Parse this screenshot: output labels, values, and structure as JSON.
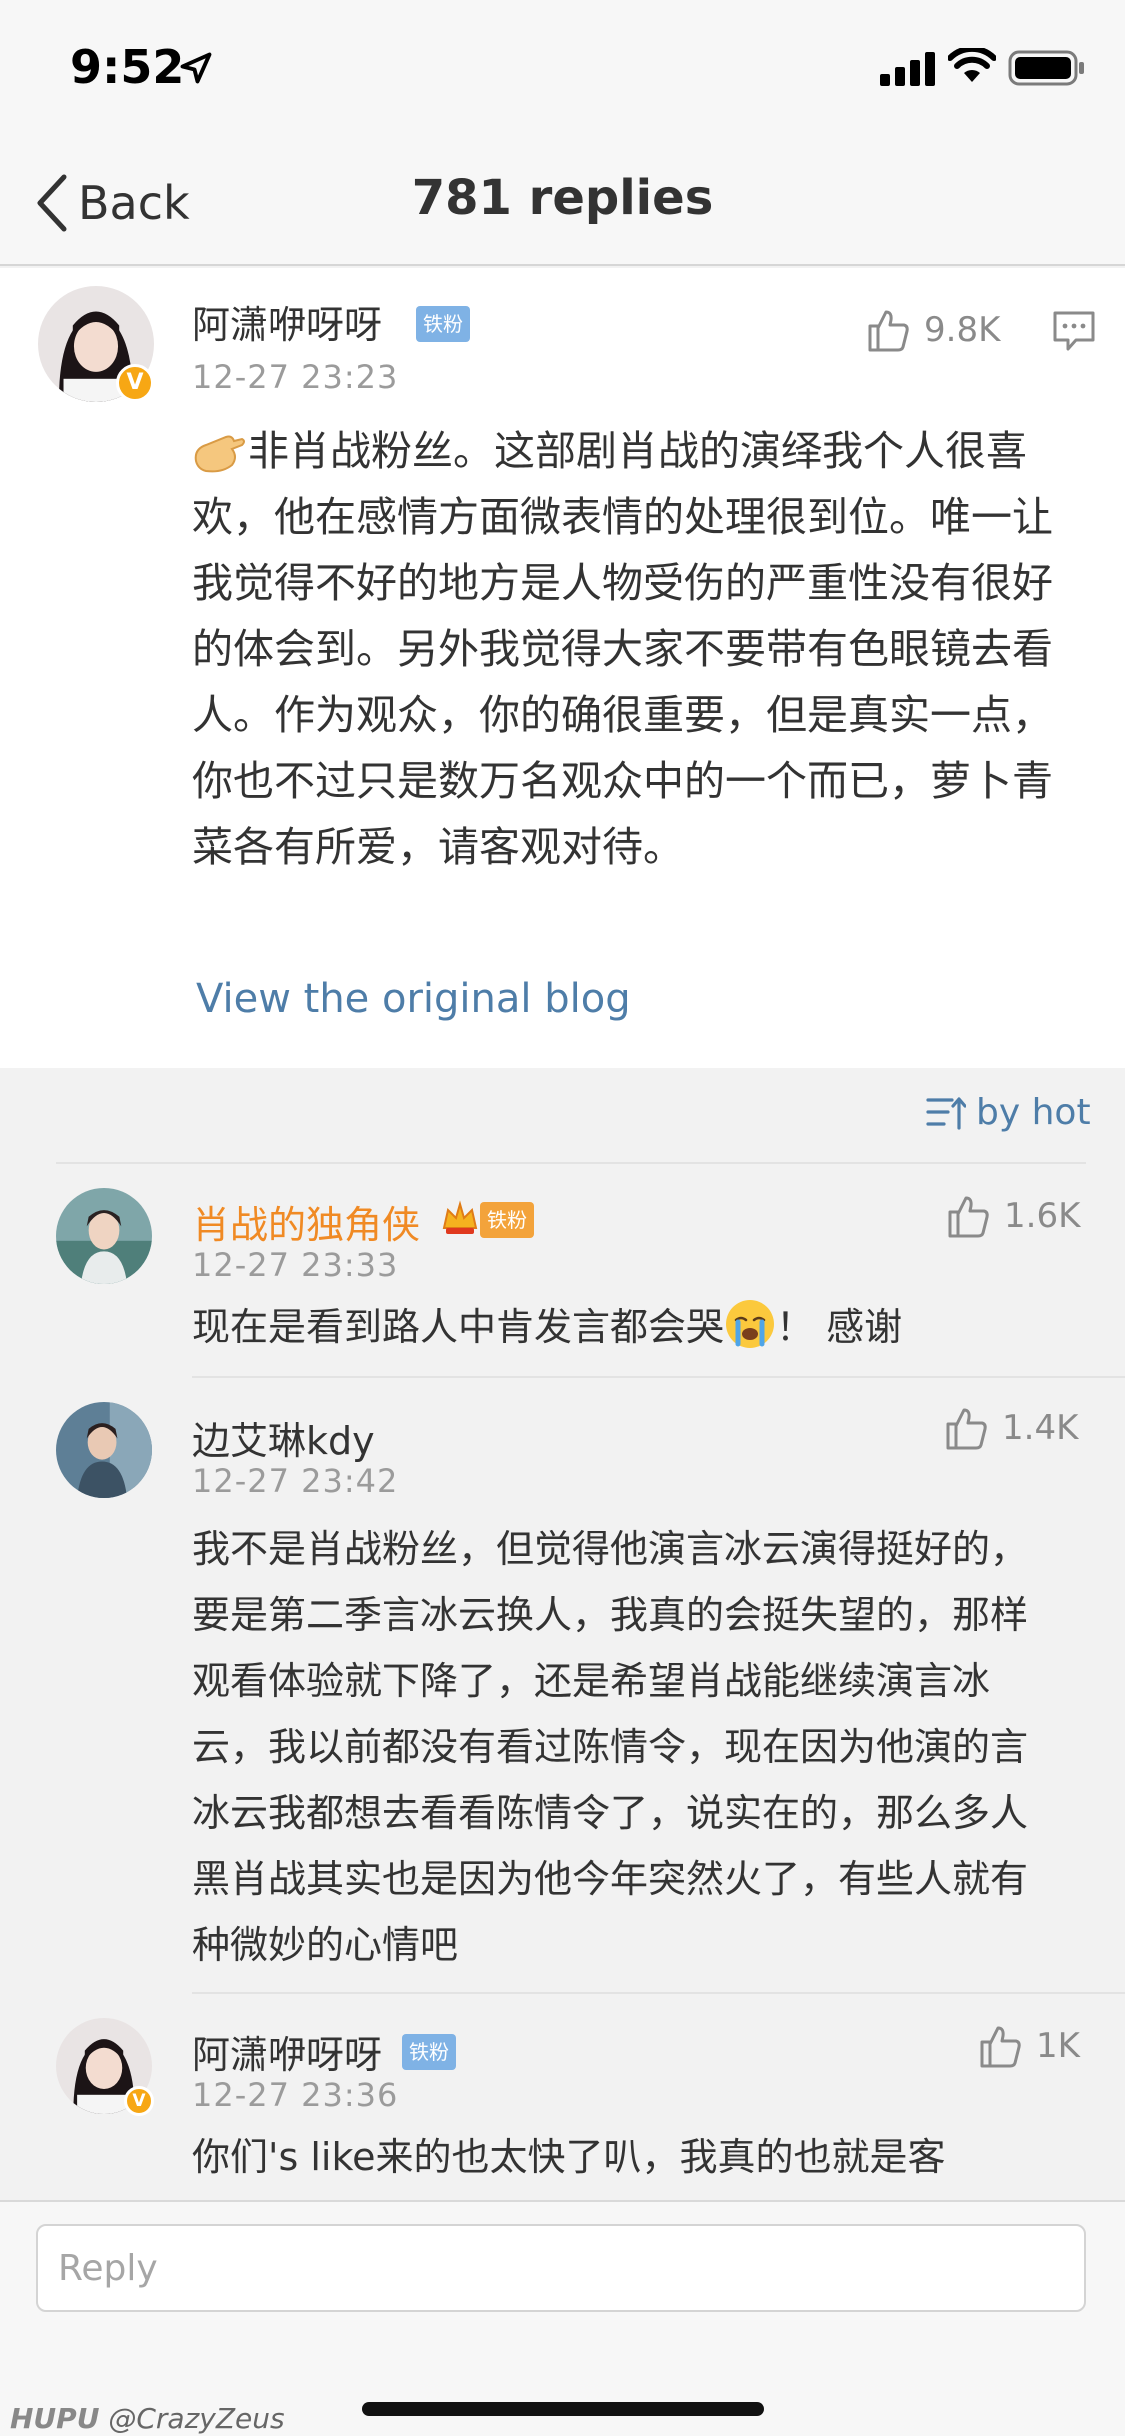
{
  "status_bar": {
    "time": "9:52"
  },
  "nav": {
    "back_label": "Back",
    "title": "781 replies"
  },
  "main_post": {
    "username": "阿潇咿呀呀",
    "tag": "铁粉",
    "timestamp": "12-27 23:23",
    "likes": "9.8K",
    "body": "非肖战粉丝。这部剧肖战的演绎我个人很喜欢，他在感情方面微表情的处理很到位。唯一让我觉得不好的地方是人物受伤的严重性没有很好的体会到。另外我觉得大家不要带有色眼镜去看人。作为观众，你的确很重要，但是真实一点，你也不过只是数万名观众中的一个而已，萝卜青菜各有所爱，请客观对待。",
    "view_original": "View the original blog"
  },
  "sort": {
    "label": "by hot"
  },
  "comments": [
    {
      "username": "肖战的独角侠",
      "tag": "铁粉",
      "timestamp": "12-27 23:33",
      "likes": "1.6K",
      "text_before": "现在是看到路人中肯发言都会哭",
      "text_after": "！ 感谢"
    },
    {
      "username": "边艾琳kdy",
      "timestamp": "12-27 23:42",
      "likes": "1.4K",
      "text": "我不是肖战粉丝，但觉得他演言冰云演得挺好的，要是第二季言冰云换人，我真的会挺失望的，那样观看体验就下降了，还是希望肖战能继续演言冰云，我以前都没有看过陈情令，现在因为他演的言冰云我都想去看看陈情令了，说实在的，那么多人黑肖战其实也是因为他今年突然火了，有些人就有种微妙的心情吧"
    },
    {
      "username": "阿潇咿呀呀",
      "tag": "铁粉",
      "timestamp": "12-27 23:36",
      "likes": "1K",
      "text": "你们's like来的也太快了叭，我真的也就是客"
    }
  ],
  "reply": {
    "placeholder": "Reply"
  },
  "watermark": {
    "brand": "HUPU",
    "handle": "@CrazyZeus"
  }
}
